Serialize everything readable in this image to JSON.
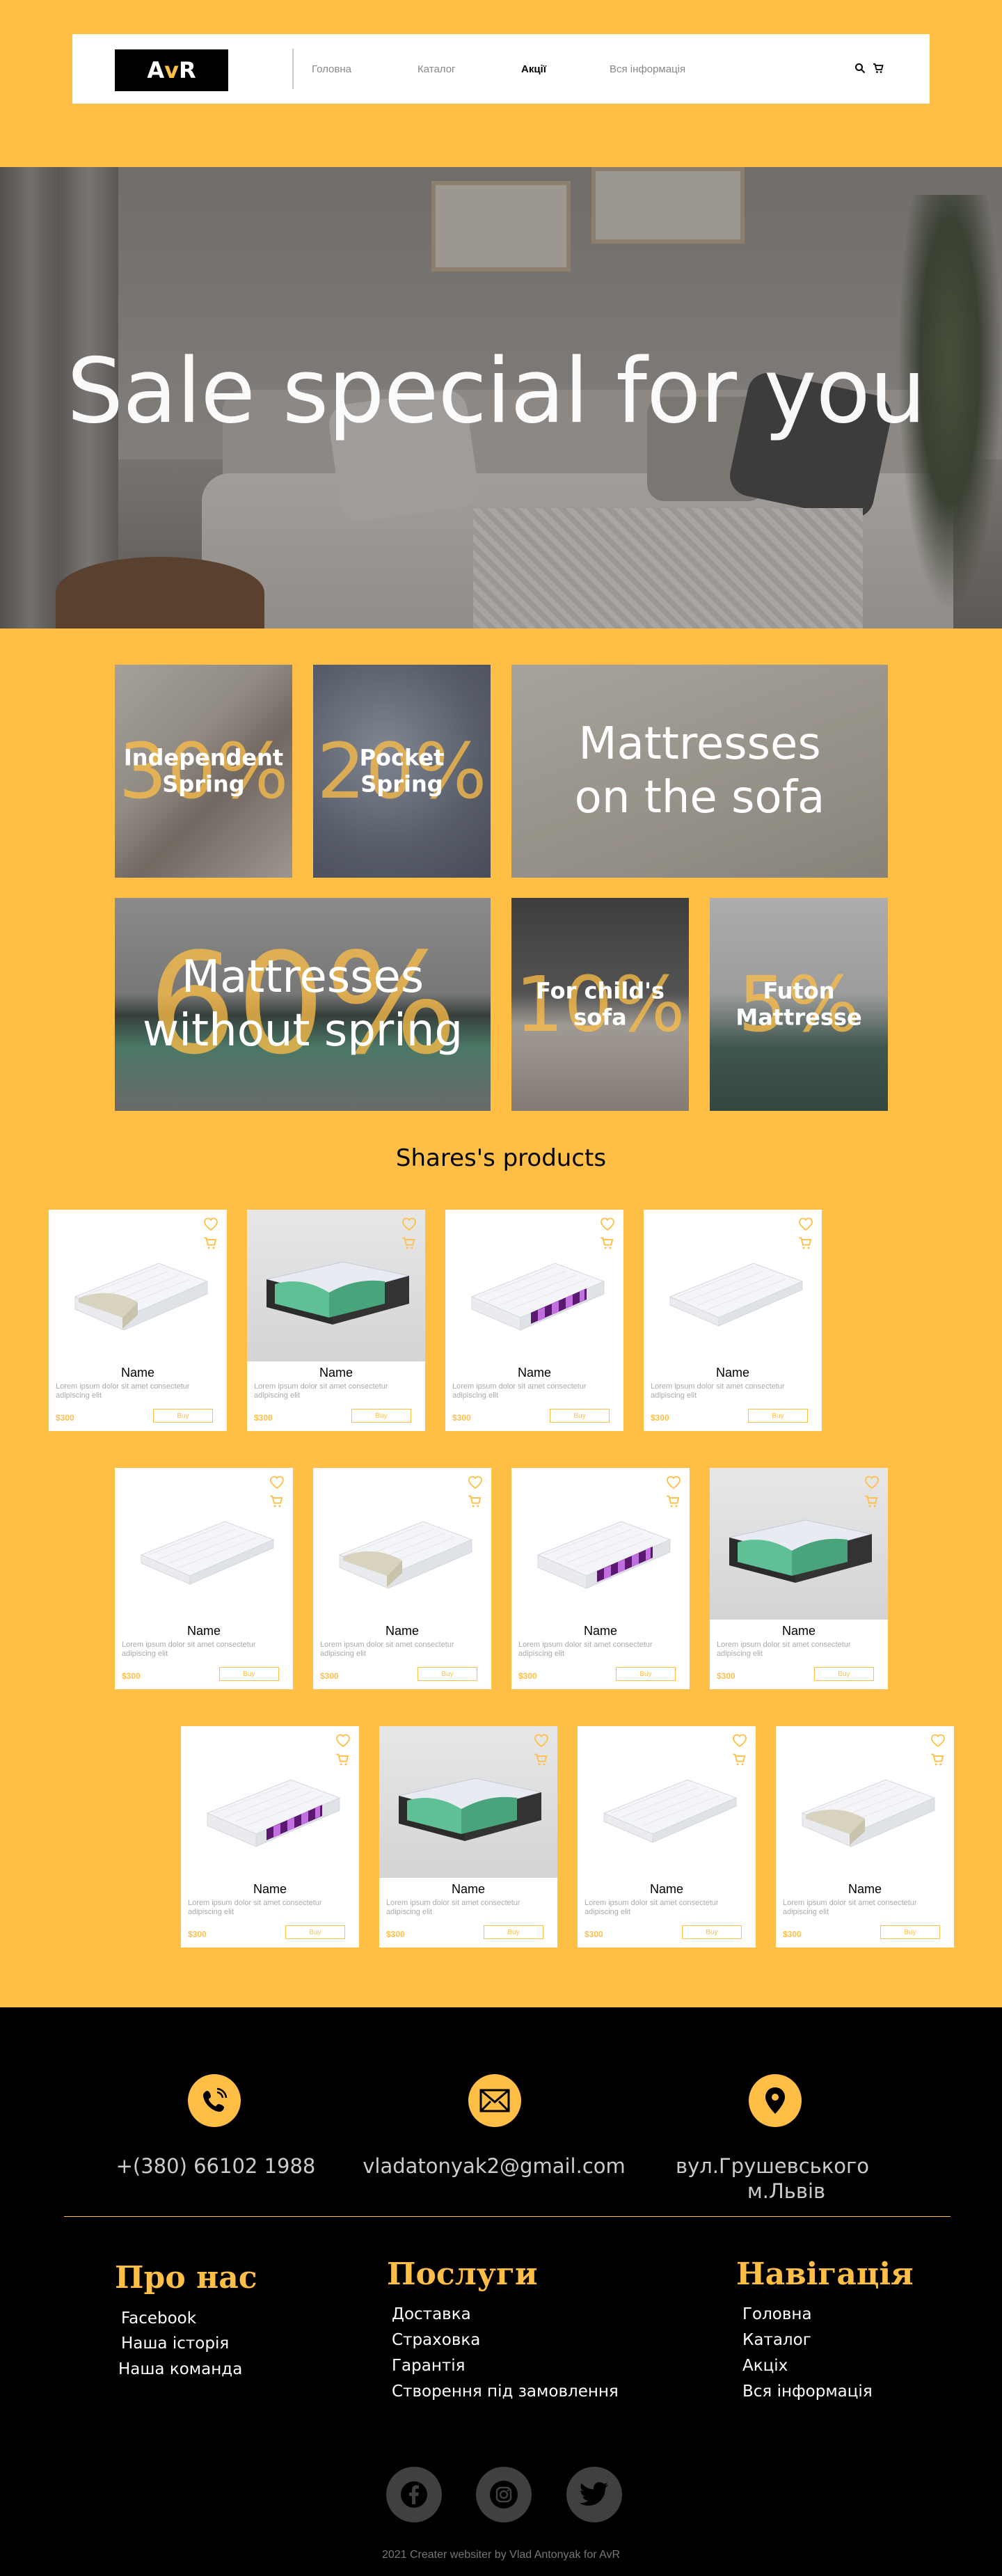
{
  "header": {
    "logo": {
      "part1": "A",
      "part2": "v",
      "part3": "R"
    },
    "nav": [
      {
        "label": "Головна",
        "active": false
      },
      {
        "label": "Каталог",
        "active": false
      },
      {
        "label": "Акції",
        "active": true
      },
      {
        "label": "Вся інформація",
        "active": false
      }
    ],
    "icons": [
      "search-icon",
      "cart-icon"
    ]
  },
  "hero": {
    "title": "Sale special for you"
  },
  "sales": [
    {
      "percent": "30%",
      "label": "Independent Spring"
    },
    {
      "percent": "20%",
      "label": "Pocket Spring"
    },
    {
      "percent": "",
      "label": "Mattresses on the sofa"
    },
    {
      "percent": "60%",
      "label": "Mattresses without spring"
    },
    {
      "percent": "10%",
      "label": "For child's sofa"
    },
    {
      "percent": "5%",
      "label": "Futon Mattresse"
    }
  ],
  "shares": {
    "title": "Shares's products"
  },
  "products": [
    {
      "name": "Name",
      "desc": "Lorem ipsum dolor sit amet consectetur adipiscing elit",
      "price": "$300",
      "buy": "Buy",
      "kind": "foam-half"
    },
    {
      "name": "Name",
      "desc": "Lorem ipsum dolor sit amet consectetur adipiscing elit",
      "price": "$300",
      "buy": "Buy",
      "kind": "green"
    },
    {
      "name": "Name",
      "desc": "Lorem ipsum dolor sit amet consectetur adipiscing elit",
      "price": "$300",
      "buy": "Buy",
      "kind": "purple"
    },
    {
      "name": "Name",
      "desc": "Lorem ipsum dolor sit amet consectetur adipiscing elit",
      "price": "$300",
      "buy": "Buy",
      "kind": "plain"
    },
    {
      "name": "Name",
      "desc": "Lorem ipsum dolor sit amet consectetur adipiscing elit",
      "price": "$300",
      "buy": "Buy",
      "kind": "plain"
    },
    {
      "name": "Name",
      "desc": "Lorem ipsum dolor sit amet consectetur adipiscing elit",
      "price": "$300",
      "buy": "Buy",
      "kind": "foam-half"
    },
    {
      "name": "Name",
      "desc": "Lorem ipsum dolor sit amet consectetur adipiscing elit",
      "price": "$300",
      "buy": "Buy",
      "kind": "purple"
    },
    {
      "name": "Name",
      "desc": "Lorem ipsum dolor sit amet consectetur adipiscing elit",
      "price": "$300",
      "buy": "Buy",
      "kind": "green"
    },
    {
      "name": "Name",
      "desc": "Lorem ipsum dolor sit amet consectetur adipiscing elit",
      "price": "$300",
      "buy": "Buy",
      "kind": "purple"
    },
    {
      "name": "Name",
      "desc": "Lorem ipsum dolor sit amet consectetur adipiscing elit",
      "price": "$300",
      "buy": "Buy",
      "kind": "green"
    },
    {
      "name": "Name",
      "desc": "Lorem ipsum dolor sit amet consectetur adipiscing elit",
      "price": "$300",
      "buy": "Buy",
      "kind": "plain"
    },
    {
      "name": "Name",
      "desc": "Lorem ipsum dolor sit amet consectetur adipiscing elit",
      "price": "$300",
      "buy": "Buy",
      "kind": "foam-half"
    }
  ],
  "footer": {
    "phone": "+(380) 66102 1988",
    "email": "vladatonyak2@gmail.com",
    "address_line1": "вул.Грушевського",
    "address_line2": "м.Львів",
    "about": {
      "title": "Про нас",
      "links": [
        "Facebook",
        "Наша історія",
        "Наша команда"
      ]
    },
    "services": {
      "title": "Послуги",
      "links": [
        "Доставка",
        "Страховка",
        "Гарантія",
        "Створення під замовлення"
      ]
    },
    "navigation": {
      "title": "Навігація",
      "links": [
        "Головна",
        "Каталог",
        "Акціх",
        "Вся інформація"
      ]
    },
    "social": [
      "facebook-icon",
      "instagram-icon",
      "twitter-icon"
    ],
    "copyright": "2021 Creater websiter by Vlad Antonyak for AvR"
  },
  "colors": {
    "accent": "#FFBF47",
    "dark": "#000000",
    "white": "#FFFFFF"
  }
}
